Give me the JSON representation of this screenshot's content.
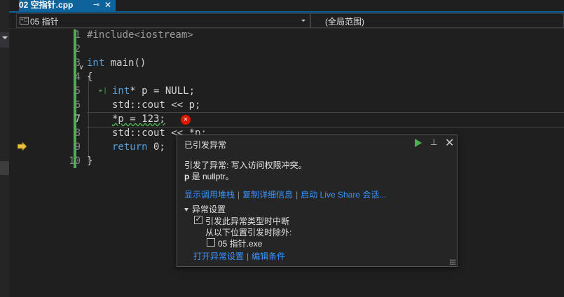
{
  "tab": {
    "title": "02 空指针.cpp",
    "pin_icon": "⊸",
    "close_icon": "✕"
  },
  "navbar": {
    "scope": "05 指针",
    "scope_icon": "+◻",
    "global_scope": "(全局范围)"
  },
  "code": {
    "line_numbers": [
      "1",
      "2",
      "3",
      "4",
      "5",
      "6",
      "7",
      "8",
      "9",
      "10"
    ],
    "lines": {
      "l1_pp": "#include<iostream>",
      "l3_kw": "int",
      "l3_rest": " main()",
      "l4": "{",
      "l5_kw": "int",
      "l5_rest": "* p = NULL;",
      "l6": "std::cout << p;",
      "l7_a": "*p = 123;",
      "l8_a": "std::cout ",
      "l8_b": "<< *p;",
      "l9_kw": "return",
      "l9_rest": " 0;",
      "l10": "}"
    },
    "fold_glyph": "∨",
    "error_glyph": "✕",
    "step_glyph": "▸|"
  },
  "exception_popup": {
    "title": "已引发异常",
    "message_line1": "引发了异常: 写入访问权限冲突。",
    "message_var": "p",
    "message_line2_rest": " 是 nullptr。",
    "links": {
      "call_stack": "显示调用堆栈",
      "copy_details": "复制详细信息",
      "live_share": "启动 Live Share 会话..."
    },
    "section": "异常设置",
    "option_break": "引发此异常类型时中断",
    "option_except": "从以下位置引发时除外:",
    "option_module": "05 指针.exe",
    "option_break_checked": true,
    "option_module_checked": false,
    "footer_links": {
      "open_settings": "打开异常设置",
      "edit_conditions": "编辑条件"
    },
    "pin_icon": "⊥",
    "close_icon": "✕"
  },
  "colors": {
    "accent": "#0e639c",
    "keyword": "#569cd6",
    "link": "#3794ff",
    "error": "#e51400",
    "change_bar": "#4caf50"
  }
}
